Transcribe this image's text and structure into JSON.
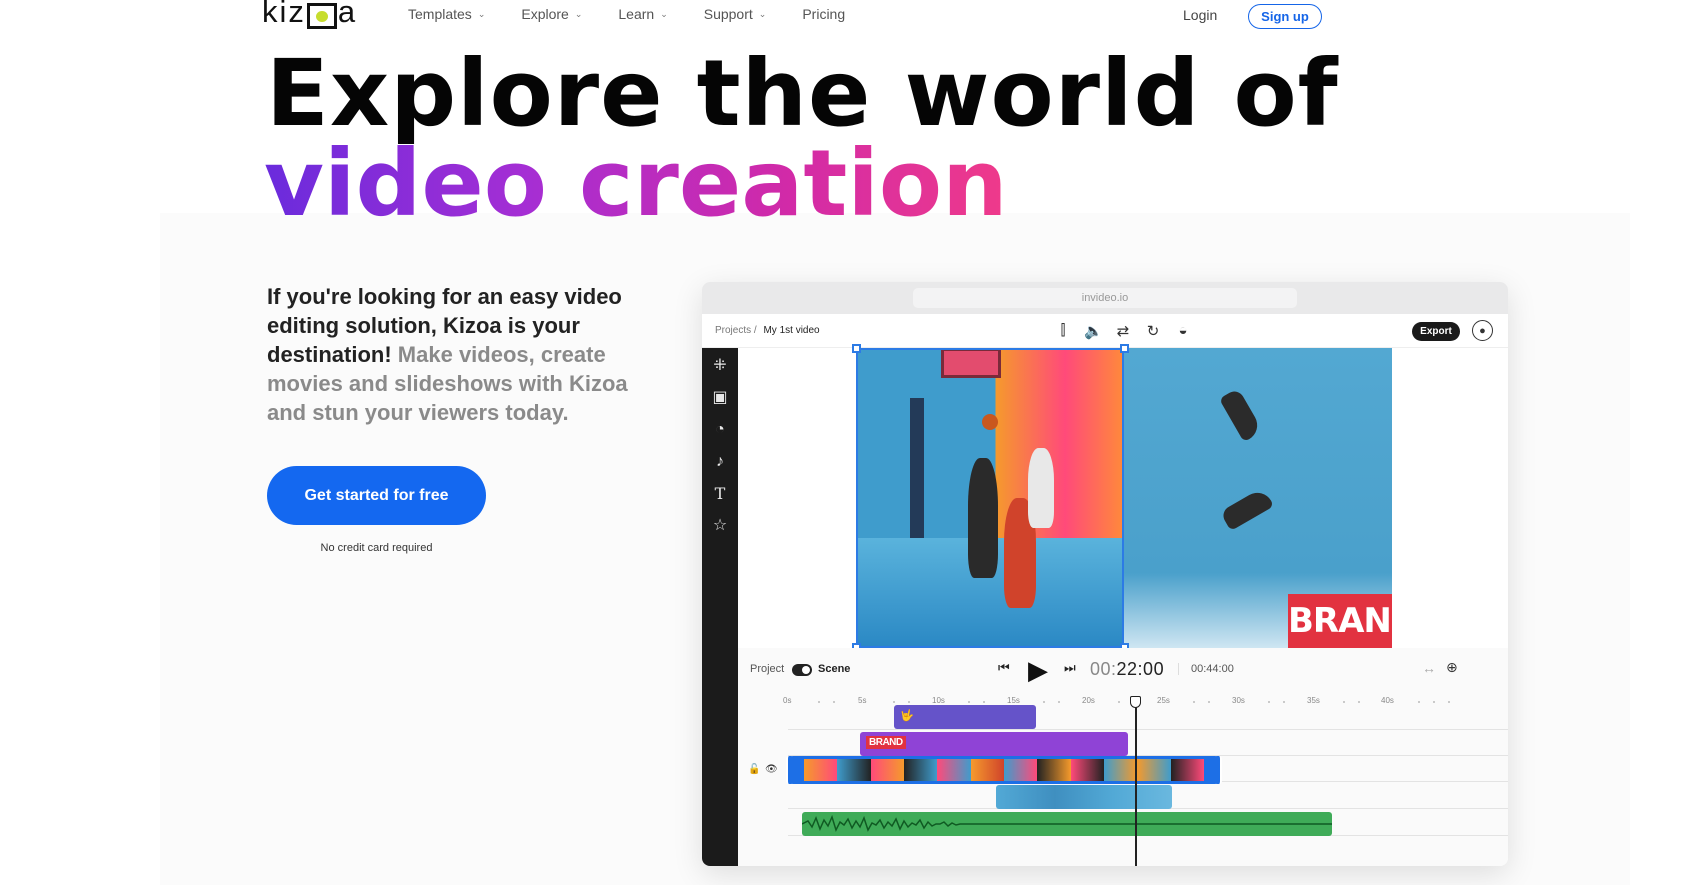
{
  "nav": {
    "logo": "kizoa",
    "items": [
      {
        "label": "Templates",
        "has_menu": true
      },
      {
        "label": "Explore",
        "has_menu": true
      },
      {
        "label": "Learn",
        "has_menu": true
      },
      {
        "label": "Support",
        "has_menu": true
      },
      {
        "label": "Pricing",
        "has_menu": false
      }
    ],
    "login": "Login",
    "signup": "Sign up"
  },
  "hero": {
    "line1": "Explore the world of",
    "line2": "video creation",
    "desc_strong": "If you're looking for an easy video editing solution, Kizoa is your destination!",
    "desc_muted": "Make videos, create movies and slideshows with Kizoa and stun your viewers today.",
    "cta": "Get started for free",
    "cta_note": "No credit card required"
  },
  "editor": {
    "url": "invideo.io",
    "breadcrumb_root": "Projects",
    "breadcrumb_sep": "/",
    "breadcrumb_current": "My 1st video",
    "export": "Export",
    "brand_text": "BRAND",
    "project_label": "Project",
    "scene_label": "Scene",
    "current_time_dim": "00:",
    "current_time": "22:00",
    "total_time": "00:44:00",
    "ruler": [
      "0s",
      "5s",
      "10s",
      "15s",
      "20s",
      "25s",
      "30s",
      "35s",
      "40s"
    ],
    "sticker_clip_label": "🤟",
    "brand_clip_label": "BRAND"
  },
  "colors": {
    "primary": "#1468f0",
    "gradient_start": "#6a2bdc",
    "gradient_end": "#ef3a8a",
    "clip_indigo": "#6553c9",
    "clip_purple": "#8f43d6",
    "clip_blue": "#1d6fe6",
    "clip_teal": "#52a9d6",
    "clip_green": "#3fab58"
  }
}
